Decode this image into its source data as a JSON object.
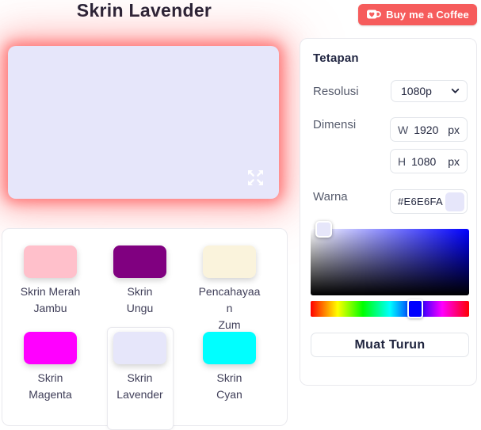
{
  "header": {
    "title": "Skrin Lavender",
    "coffee_button_label": "Buy me a Coffee",
    "coffee_button_color": "#F65C5C"
  },
  "preview": {
    "color": "#E6E6FA",
    "glow_color": "#FF5A5A"
  },
  "swatches": [
    {
      "name": "Skrin Merah Jambu",
      "line1": "Skrin Merah",
      "line2": "Jambu",
      "color": "#FFC0CB",
      "selected": false
    },
    {
      "name": "Skrin Ungu",
      "line1": "Skrin",
      "line2": "Ungu",
      "color": "#800080",
      "selected": false
    },
    {
      "name": "Pencahayaan Zum",
      "line1": "Pencahayaan",
      "line2": "Zum",
      "color": "#FAF3DC",
      "selected": false
    },
    {
      "name": "Skrin Magenta",
      "line1": "Skrin",
      "line2": "Magenta",
      "color": "#FF00FF",
      "selected": false
    },
    {
      "name": "Skrin Lavender",
      "line1": "Skrin",
      "line2": "Lavender",
      "color": "#E6E6FA",
      "selected": true
    },
    {
      "name": "Skrin Cyan",
      "line1": "Skrin",
      "line2": "Cyan",
      "color": "#00FFFF",
      "selected": false
    }
  ],
  "settings": {
    "title": "Tetapan",
    "resolution_label": "Resolusi",
    "resolution_value": "1080p",
    "dimension_label": "Dimensi",
    "width_prefix": "W",
    "width_value": "1920",
    "width_unit": "px",
    "height_prefix": "H",
    "height_value": "1080",
    "height_unit": "px",
    "color_label": "Warna",
    "color_value": "#E6E6FA",
    "download_label": "Muat Turun",
    "picker": {
      "hue_color": "#0000FF",
      "selected_color": "#E6E6FA",
      "hue_position_pct": 67
    }
  }
}
